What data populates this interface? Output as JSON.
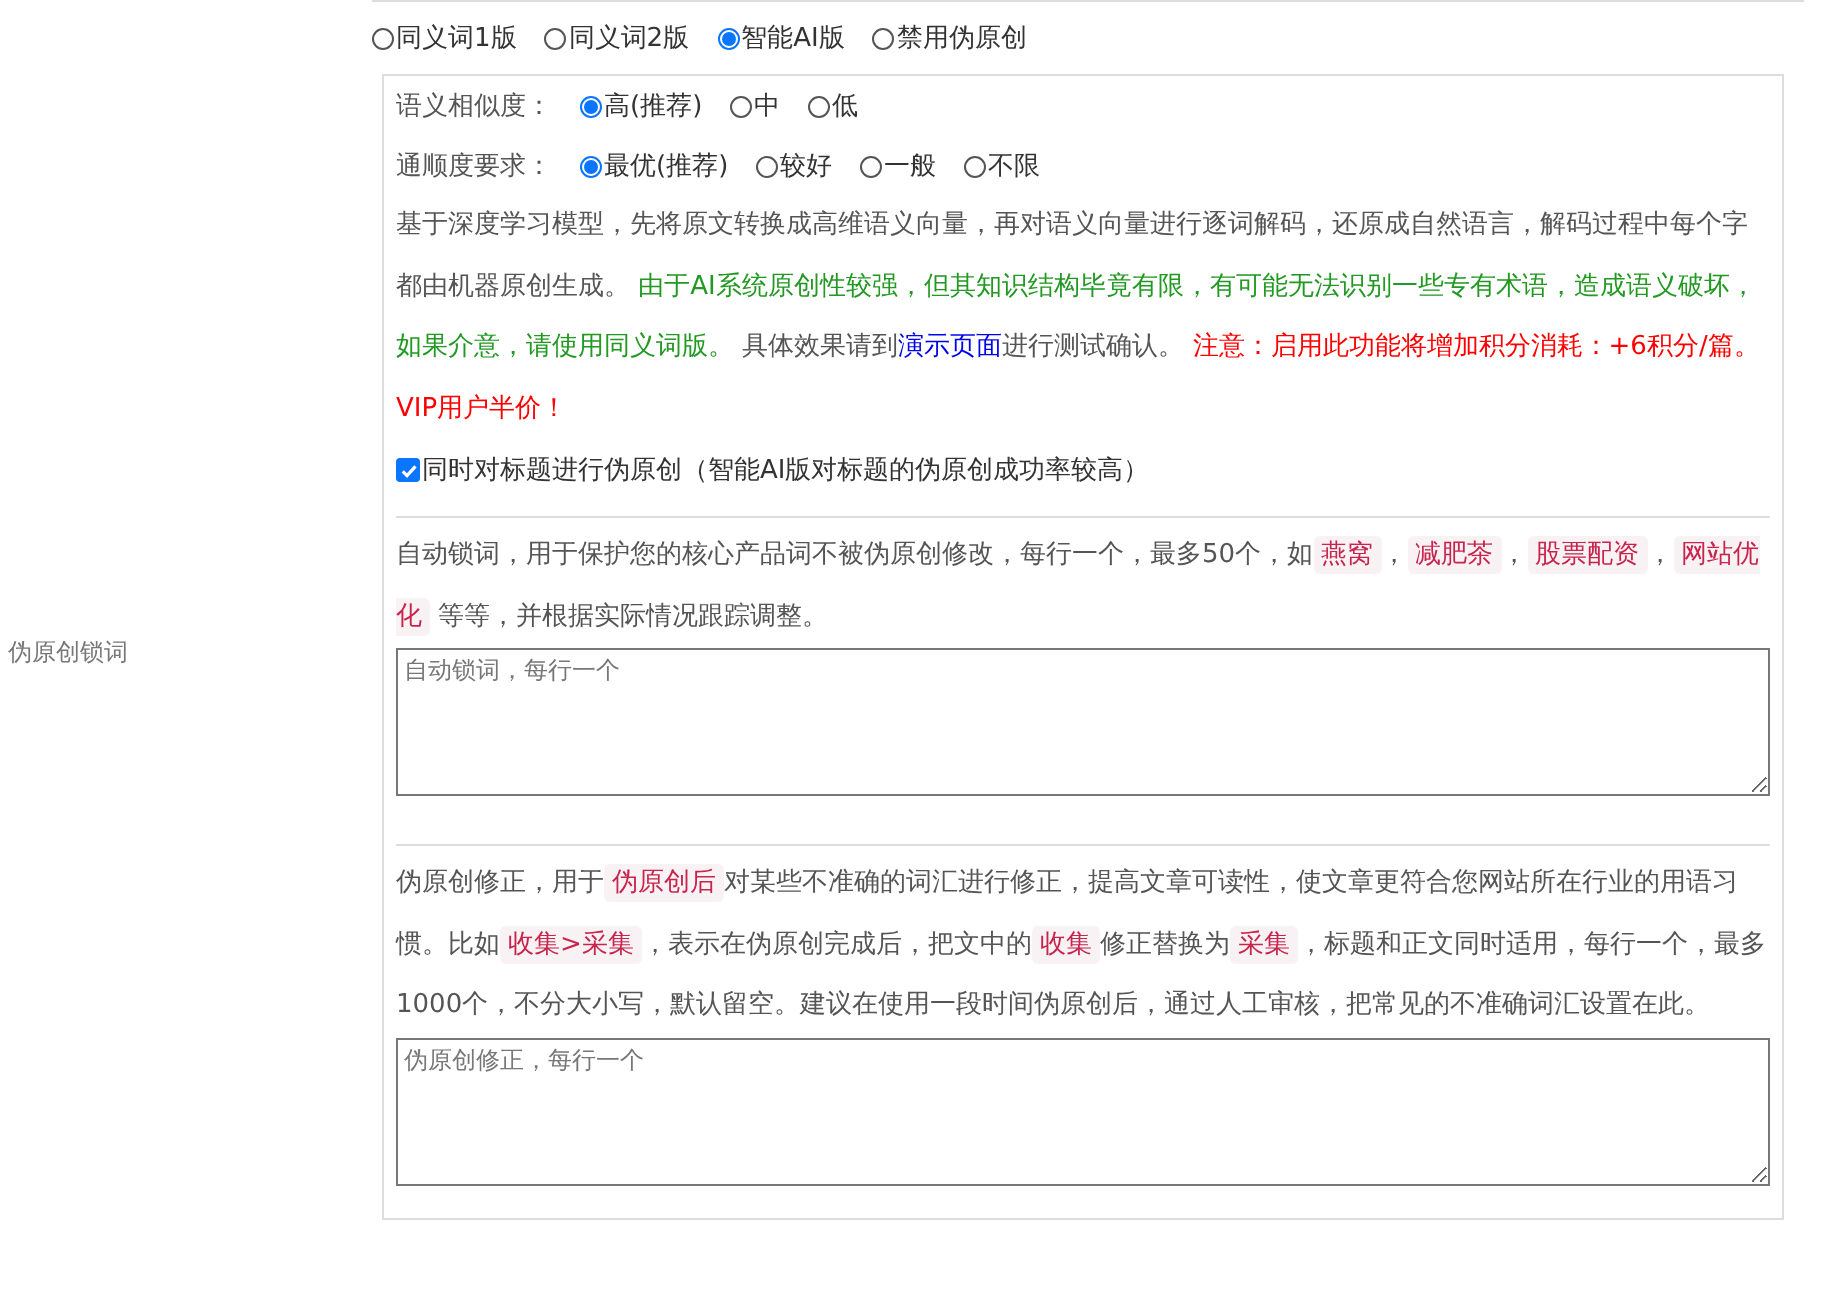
{
  "modes": [
    {
      "label": "同义词1版",
      "selected": false
    },
    {
      "label": "同义词2版",
      "selected": false
    },
    {
      "label": "智能AI版",
      "selected": true
    },
    {
      "label": "禁用伪原创",
      "selected": false
    }
  ],
  "similarity": {
    "label": "语义相似度：",
    "options": [
      {
        "label": "高(推荐)",
        "selected": true
      },
      {
        "label": "中",
        "selected": false
      },
      {
        "label": "低",
        "selected": false
      }
    ]
  },
  "fluency": {
    "label": "通顺度要求：",
    "options": [
      {
        "label": "最优(推荐)",
        "selected": true
      },
      {
        "label": "较好",
        "selected": false
      },
      {
        "label": "一般",
        "selected": false
      },
      {
        "label": "不限",
        "selected": false
      }
    ]
  },
  "ai_description": [
    {
      "kind": "normal",
      "text": "基于深度学习模型，先将原文转换成高维语义向量，再对语义向量进行逐词解码，还原成自然语言，解码过程中每个字都由机器原创生成。 "
    },
    {
      "kind": "green",
      "text": "由于AI系统原创性较强，但其知识结构毕竟有限，有可能无法识别一些专有术语，造成语义破坏，如果介意，请使用同义词版。"
    },
    {
      "kind": "normal",
      "text": " 具体效果请到"
    },
    {
      "kind": "link",
      "text": "演示页面"
    },
    {
      "kind": "normal",
      "text": "进行测试确认。 "
    },
    {
      "kind": "red",
      "text": "注意：启用此功能将增加积分消耗：+6积分/篇。VIP用户半价！"
    }
  ],
  "title_option": {
    "label": "同时对标题进行伪原创（智能AI版对标题的伪原创成功率较高）",
    "checked": true
  },
  "lock_words": {
    "label": "伪原创锁词",
    "description": [
      {
        "kind": "normal",
        "text": "自动锁词，用于保护您的核心产品词不被伪原创修改，每行一个，最多50个，如"
      },
      {
        "kind": "tag",
        "text": "燕窝"
      },
      {
        "kind": "normal",
        "text": "，"
      },
      {
        "kind": "tag",
        "text": "减肥茶"
      },
      {
        "kind": "normal",
        "text": "，"
      },
      {
        "kind": "tag",
        "text": "股票配资"
      },
      {
        "kind": "normal",
        "text": "，"
      },
      {
        "kind": "tag",
        "text": "网站优化"
      },
      {
        "kind": "normal",
        "text": " 等等，并根据实际情况跟踪调整。"
      }
    ],
    "placeholder": "自动锁词，每行一个"
  },
  "correction": {
    "description": [
      {
        "kind": "normal",
        "text": "伪原创修正，用于"
      },
      {
        "kind": "tag",
        "text": "伪原创后"
      },
      {
        "kind": "normal",
        "text": "对某些不准确的词汇进行修正，提高文章可读性，使文章更符合您网站所在行业的用语习惯。比如"
      },
      {
        "kind": "tag",
        "text": "收集>采集"
      },
      {
        "kind": "normal",
        "text": "，表示在伪原创完成后，把文中的"
      },
      {
        "kind": "tag",
        "text": "收集"
      },
      {
        "kind": "normal",
        "text": "修正替换为"
      },
      {
        "kind": "tag",
        "text": "采集"
      },
      {
        "kind": "normal",
        "text": "，标题和正文同时适用，每行一个，最多1000个，不分大小写，默认留空。建议在使用一段时间伪原创后，通过人工审核，把常见的不准确词汇设置在此。"
      }
    ],
    "placeholder": "伪原创修正，每行一个"
  }
}
